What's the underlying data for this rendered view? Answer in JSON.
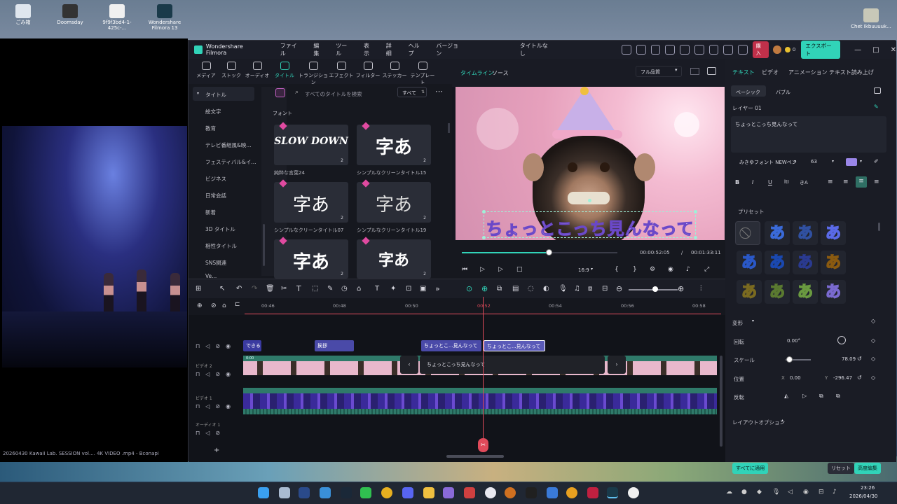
{
  "desktop": {
    "icons": [
      {
        "label": "ごみ箱",
        "icon": "recycle-bin-icon"
      },
      {
        "label": "Doomsday",
        "icon": "doomsday-icon"
      },
      {
        "label": "9f9f3bd4-1-425c-...",
        "icon": "file-icon"
      },
      {
        "label": "Wondershare Filmora 13",
        "icon": "filmora-icon"
      }
    ],
    "right_icon_label": "Chet Ikbuuuuk..."
  },
  "player": {
    "caption": "20260430 Kawaii Lab. SESSION vol.... 4K VIDEO .mp4  - Bconapi"
  },
  "app": {
    "title": "Wondershare Filmora",
    "menu": [
      "ファイル",
      "編集",
      "ツール",
      "表示",
      "詳細",
      "ヘルプ",
      "バージョン"
    ],
    "project_title": "タイトルなし",
    "buy_label": "購入",
    "credits": "0",
    "export_label": "エクスポート",
    "accent": "#31d3b8",
    "window_buttons": [
      "minimize-icon",
      "maximize-icon",
      "close-icon"
    ]
  },
  "toolbar": {
    "items": [
      {
        "label": "メディア",
        "icon": "media-icon",
        "active": false
      },
      {
        "label": "ストック",
        "icon": "stock-icon",
        "active": false
      },
      {
        "label": "オーディオ",
        "icon": "audio-icon",
        "active": false
      },
      {
        "label": "タイトル",
        "icon": "title-icon",
        "active": true
      },
      {
        "label": "トランジション",
        "icon": "transition-icon",
        "active": false
      },
      {
        "label": "エフェクト",
        "icon": "effect-icon",
        "active": false
      },
      {
        "label": "フィルター",
        "icon": "filter-icon",
        "active": false
      },
      {
        "label": "ステッカー",
        "icon": "sticker-icon",
        "active": false
      },
      {
        "label": "テンプレート",
        "icon": "template-icon",
        "active": false
      }
    ]
  },
  "library": {
    "categories": [
      "タイトル",
      "絵文字",
      "教育",
      "テレビ番組風&映...",
      "フェスティバル&イ...",
      "ビジネス",
      "日常会話",
      "新着",
      "3D タイトル",
      "相性タイトル",
      "SNS関連",
      "Ve..."
    ],
    "search_placeholder": "すべてのタイトルを検索",
    "filter_label": "すべて",
    "section_label": "フォント",
    "thumbs": [
      {
        "text": "SLOW DOWN",
        "label": "純粋な言葉24",
        "count": "2"
      },
      {
        "text": "字あ",
        "label": "シンプルなクリーンタイトル15",
        "count": "2"
      },
      {
        "text": "字あ",
        "label": "シンプルなクリーンタイトル07",
        "count": "2"
      },
      {
        "text": "字あ",
        "label": "シンプルなクリーンタイトル19",
        "count": "2"
      },
      {
        "text": "字あ",
        "label": "",
        "count": "2"
      },
      {
        "text": "字あ",
        "label": "",
        "count": "2"
      }
    ]
  },
  "preview": {
    "tabs": [
      "タイムライン",
      "ソース"
    ],
    "quality": "フル品質",
    "overlay_text": "ちょっとこっち見んなって",
    "time_current": "00:00:52:05",
    "time_separator": "/",
    "time_total": "00:01:33:11",
    "progress": 0.56,
    "aspect": "16:9"
  },
  "props": {
    "tabs": [
      "テキスト",
      "ビデオ",
      "アニメーション",
      "テキスト読み上げ"
    ],
    "subtabs": [
      "ベーシック",
      "バブル"
    ],
    "layer_label": "レイヤー 01",
    "text_value": "ちょっとこっち見んなって",
    "font": "みきゆフォント NEWペン",
    "font_size": "63",
    "text_color": "#9a86e8",
    "format_buttons": [
      "B",
      "I",
      "U",
      "ltI",
      "きA"
    ],
    "preset_label": "プリセット",
    "presets": [
      "あ",
      "あ",
      "あ",
      "あ",
      "あ",
      "あ",
      "あ",
      "あ",
      "あ",
      "あ",
      "あ"
    ],
    "transform_label": "変形",
    "rotation_label": "回転",
    "rotation": "0.00°",
    "scale_label": "スケール",
    "scale": "78.09",
    "position_label": "位置",
    "pos_x": "0.00",
    "pos_y": "-296.47",
    "flip_label": "反転",
    "layout_label": "レイアウトオプション",
    "apply_all": "すべてに適用",
    "reset": "リセット",
    "advanced": "高度編集"
  },
  "timeline": {
    "ticks": [
      "00:46",
      "00:48",
      "00:50",
      "00:52",
      "00:54",
      "00:56",
      "00:58"
    ],
    "track_labels": [
      "ビデオ 2",
      "ビデオ 1",
      "オーディオ 1"
    ],
    "clips": [
      {
        "text": "できる",
        "color": "#3a3aa0"
      },
      {
        "text": "挨拶",
        "color": "#4a4aa8"
      },
      {
        "text": "ちょっとこ...見んなって",
        "color": "#4a4aa8"
      },
      {
        "text": "ちょっとこ...見んなって",
        "color": "#5a5ab8"
      }
    ],
    "edit_text": "ちょっとこっち見んなって",
    "clip_start": "0:00"
  },
  "taskbar": {
    "time": "23:26",
    "date": "2026/04/30"
  }
}
